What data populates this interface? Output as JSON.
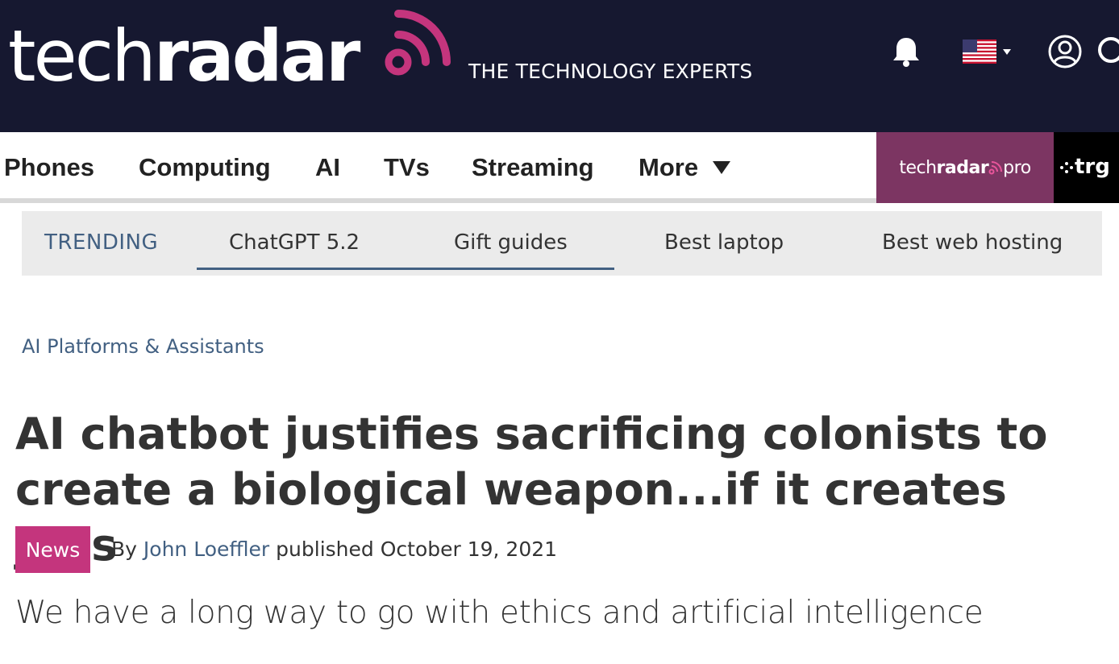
{
  "header": {
    "logo_regular": "tech",
    "logo_bold": "radar",
    "tagline": "THE TECHNOLOGY EXPERTS",
    "icons": [
      "bell-icon",
      "us-flag-icon",
      "user-icon",
      "search-icon"
    ],
    "colors": {
      "background": "#161830",
      "accent": "#c4357d"
    }
  },
  "nav": {
    "items": [
      {
        "label": "Phones"
      },
      {
        "label": "Computing"
      },
      {
        "label": "AI"
      },
      {
        "label": "TVs"
      },
      {
        "label": "Streaming"
      },
      {
        "label": "More"
      }
    ],
    "pro_logo_regular": "tech",
    "pro_logo_bold": "radar",
    "pro_logo_suffix": "pro",
    "trg_label": "trg",
    "colors": {
      "pro": "#7c3562",
      "trg": "#000000"
    }
  },
  "trending": {
    "label": "TRENDING",
    "items": [
      {
        "label": "ChatGPT 5.2"
      },
      {
        "label": "Gift guides"
      },
      {
        "label": "Best laptop"
      },
      {
        "label": "Best web hosting"
      }
    ]
  },
  "article": {
    "breadcrumb": "AI Platforms & Assistants",
    "headline": "AI chatbot justifies sacrificing colonists to create a biological weapon...if it creates jobs",
    "badge": "News",
    "by_prefix": "By",
    "author": "John Loeffler",
    "published_text": "published October 19, 2021",
    "subtitle": "We have a long way to go with ethics and artificial intelligence",
    "colors": {
      "link": "#426082",
      "badge": "#c4357d"
    }
  }
}
